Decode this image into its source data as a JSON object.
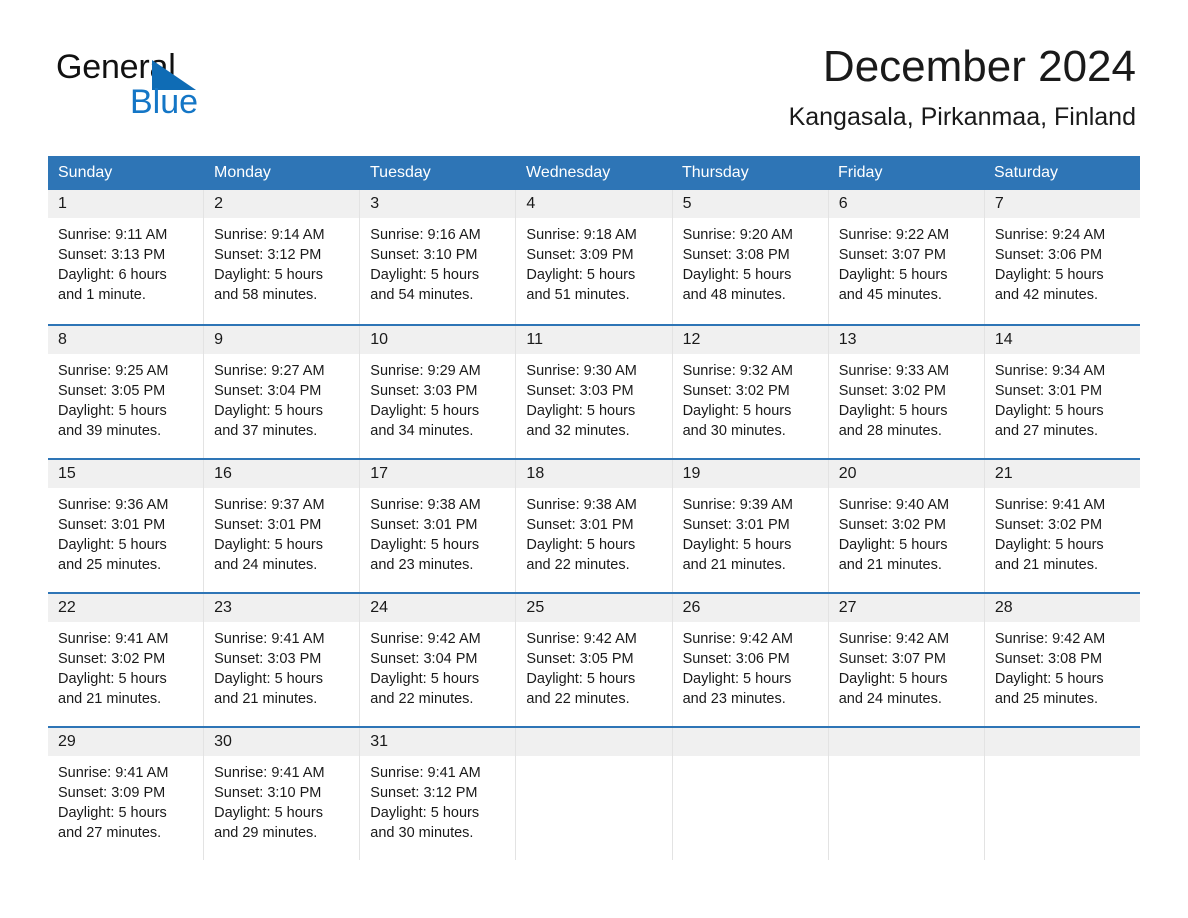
{
  "brand": {
    "name_part1": "General",
    "name_part2": "Blue",
    "triangle_color": "#0f6cb5",
    "blue_text_color": "#1476c6"
  },
  "header": {
    "month_title": "December 2024",
    "location": "Kangasala, Pirkanmaa, Finland"
  },
  "theme": {
    "header_blue": "#2e75b6",
    "daynum_band": "#f0f0f0",
    "cell_border": "#e3e3e3",
    "text": "#1a1a1a"
  },
  "weekdays": [
    "Sunday",
    "Monday",
    "Tuesday",
    "Wednesday",
    "Thursday",
    "Friday",
    "Saturday"
  ],
  "weeks": [
    [
      {
        "day": "1",
        "sunrise": "Sunrise: 9:11 AM",
        "sunset": "Sunset: 3:13 PM",
        "daylight_1": "Daylight: 6 hours",
        "daylight_2": "and 1 minute."
      },
      {
        "day": "2",
        "sunrise": "Sunrise: 9:14 AM",
        "sunset": "Sunset: 3:12 PM",
        "daylight_1": "Daylight: 5 hours",
        "daylight_2": "and 58 minutes."
      },
      {
        "day": "3",
        "sunrise": "Sunrise: 9:16 AM",
        "sunset": "Sunset: 3:10 PM",
        "daylight_1": "Daylight: 5 hours",
        "daylight_2": "and 54 minutes."
      },
      {
        "day": "4",
        "sunrise": "Sunrise: 9:18 AM",
        "sunset": "Sunset: 3:09 PM",
        "daylight_1": "Daylight: 5 hours",
        "daylight_2": "and 51 minutes."
      },
      {
        "day": "5",
        "sunrise": "Sunrise: 9:20 AM",
        "sunset": "Sunset: 3:08 PM",
        "daylight_1": "Daylight: 5 hours",
        "daylight_2": "and 48 minutes."
      },
      {
        "day": "6",
        "sunrise": "Sunrise: 9:22 AM",
        "sunset": "Sunset: 3:07 PM",
        "daylight_1": "Daylight: 5 hours",
        "daylight_2": "and 45 minutes."
      },
      {
        "day": "7",
        "sunrise": "Sunrise: 9:24 AM",
        "sunset": "Sunset: 3:06 PM",
        "daylight_1": "Daylight: 5 hours",
        "daylight_2": "and 42 minutes."
      }
    ],
    [
      {
        "day": "8",
        "sunrise": "Sunrise: 9:25 AM",
        "sunset": "Sunset: 3:05 PM",
        "daylight_1": "Daylight: 5 hours",
        "daylight_2": "and 39 minutes."
      },
      {
        "day": "9",
        "sunrise": "Sunrise: 9:27 AM",
        "sunset": "Sunset: 3:04 PM",
        "daylight_1": "Daylight: 5 hours",
        "daylight_2": "and 37 minutes."
      },
      {
        "day": "10",
        "sunrise": "Sunrise: 9:29 AM",
        "sunset": "Sunset: 3:03 PM",
        "daylight_1": "Daylight: 5 hours",
        "daylight_2": "and 34 minutes."
      },
      {
        "day": "11",
        "sunrise": "Sunrise: 9:30 AM",
        "sunset": "Sunset: 3:03 PM",
        "daylight_1": "Daylight: 5 hours",
        "daylight_2": "and 32 minutes."
      },
      {
        "day": "12",
        "sunrise": "Sunrise: 9:32 AM",
        "sunset": "Sunset: 3:02 PM",
        "daylight_1": "Daylight: 5 hours",
        "daylight_2": "and 30 minutes."
      },
      {
        "day": "13",
        "sunrise": "Sunrise: 9:33 AM",
        "sunset": "Sunset: 3:02 PM",
        "daylight_1": "Daylight: 5 hours",
        "daylight_2": "and 28 minutes."
      },
      {
        "day": "14",
        "sunrise": "Sunrise: 9:34 AM",
        "sunset": "Sunset: 3:01 PM",
        "daylight_1": "Daylight: 5 hours",
        "daylight_2": "and 27 minutes."
      }
    ],
    [
      {
        "day": "15",
        "sunrise": "Sunrise: 9:36 AM",
        "sunset": "Sunset: 3:01 PM",
        "daylight_1": "Daylight: 5 hours",
        "daylight_2": "and 25 minutes."
      },
      {
        "day": "16",
        "sunrise": "Sunrise: 9:37 AM",
        "sunset": "Sunset: 3:01 PM",
        "daylight_1": "Daylight: 5 hours",
        "daylight_2": "and 24 minutes."
      },
      {
        "day": "17",
        "sunrise": "Sunrise: 9:38 AM",
        "sunset": "Sunset: 3:01 PM",
        "daylight_1": "Daylight: 5 hours",
        "daylight_2": "and 23 minutes."
      },
      {
        "day": "18",
        "sunrise": "Sunrise: 9:38 AM",
        "sunset": "Sunset: 3:01 PM",
        "daylight_1": "Daylight: 5 hours",
        "daylight_2": "and 22 minutes."
      },
      {
        "day": "19",
        "sunrise": "Sunrise: 9:39 AM",
        "sunset": "Sunset: 3:01 PM",
        "daylight_1": "Daylight: 5 hours",
        "daylight_2": "and 21 minutes."
      },
      {
        "day": "20",
        "sunrise": "Sunrise: 9:40 AM",
        "sunset": "Sunset: 3:02 PM",
        "daylight_1": "Daylight: 5 hours",
        "daylight_2": "and 21 minutes."
      },
      {
        "day": "21",
        "sunrise": "Sunrise: 9:41 AM",
        "sunset": "Sunset: 3:02 PM",
        "daylight_1": "Daylight: 5 hours",
        "daylight_2": "and 21 minutes."
      }
    ],
    [
      {
        "day": "22",
        "sunrise": "Sunrise: 9:41 AM",
        "sunset": "Sunset: 3:02 PM",
        "daylight_1": "Daylight: 5 hours",
        "daylight_2": "and 21 minutes."
      },
      {
        "day": "23",
        "sunrise": "Sunrise: 9:41 AM",
        "sunset": "Sunset: 3:03 PM",
        "daylight_1": "Daylight: 5 hours",
        "daylight_2": "and 21 minutes."
      },
      {
        "day": "24",
        "sunrise": "Sunrise: 9:42 AM",
        "sunset": "Sunset: 3:04 PM",
        "daylight_1": "Daylight: 5 hours",
        "daylight_2": "and 22 minutes."
      },
      {
        "day": "25",
        "sunrise": "Sunrise: 9:42 AM",
        "sunset": "Sunset: 3:05 PM",
        "daylight_1": "Daylight: 5 hours",
        "daylight_2": "and 22 minutes."
      },
      {
        "day": "26",
        "sunrise": "Sunrise: 9:42 AM",
        "sunset": "Sunset: 3:06 PM",
        "daylight_1": "Daylight: 5 hours",
        "daylight_2": "and 23 minutes."
      },
      {
        "day": "27",
        "sunrise": "Sunrise: 9:42 AM",
        "sunset": "Sunset: 3:07 PM",
        "daylight_1": "Daylight: 5 hours",
        "daylight_2": "and 24 minutes."
      },
      {
        "day": "28",
        "sunrise": "Sunrise: 9:42 AM",
        "sunset": "Sunset: 3:08 PM",
        "daylight_1": "Daylight: 5 hours",
        "daylight_2": "and 25 minutes."
      }
    ],
    [
      {
        "day": "29",
        "sunrise": "Sunrise: 9:41 AM",
        "sunset": "Sunset: 3:09 PM",
        "daylight_1": "Daylight: 5 hours",
        "daylight_2": "and 27 minutes."
      },
      {
        "day": "30",
        "sunrise": "Sunrise: 9:41 AM",
        "sunset": "Sunset: 3:10 PM",
        "daylight_1": "Daylight: 5 hours",
        "daylight_2": "and 29 minutes."
      },
      {
        "day": "31",
        "sunrise": "Sunrise: 9:41 AM",
        "sunset": "Sunset: 3:12 PM",
        "daylight_1": "Daylight: 5 hours",
        "daylight_2": "and 30 minutes."
      },
      {
        "day": "",
        "sunrise": "",
        "sunset": "",
        "daylight_1": "",
        "daylight_2": ""
      },
      {
        "day": "",
        "sunrise": "",
        "sunset": "",
        "daylight_1": "",
        "daylight_2": ""
      },
      {
        "day": "",
        "sunrise": "",
        "sunset": "",
        "daylight_1": "",
        "daylight_2": ""
      },
      {
        "day": "",
        "sunrise": "",
        "sunset": "",
        "daylight_1": "",
        "daylight_2": ""
      }
    ]
  ]
}
